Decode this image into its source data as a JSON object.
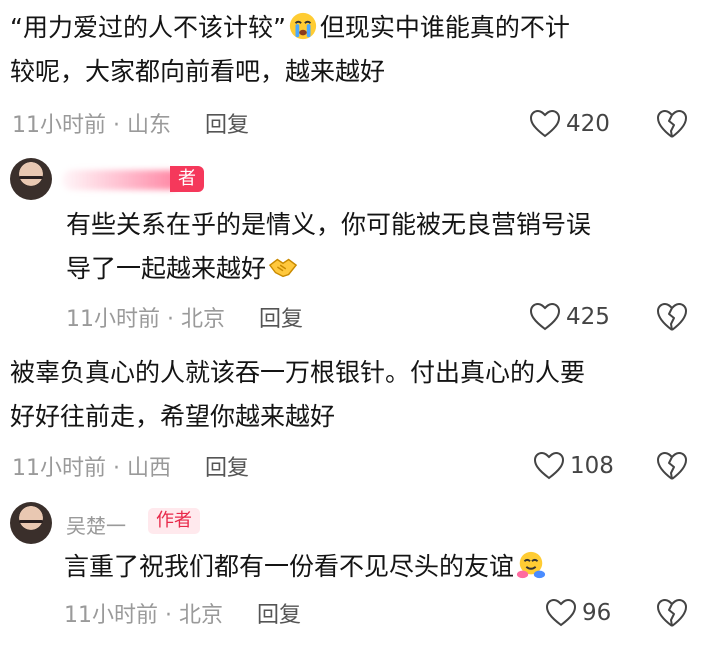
{
  "comments": [
    {
      "lines": [
        "“用力爱过的人不该计较”",
        "但现实中谁能真的不计",
        "较呢，大家都向前看吧，越来越好"
      ],
      "time": "11小时前 · 山东",
      "reply_label": "回复",
      "likes": "420",
      "emoji": "crying-face"
    },
    {
      "author_badge": "者",
      "lines": [
        "有些关系在乎的是情义，你可能被无良营销号误",
        "导了一起越来越好"
      ],
      "time": "11小时前 · 北京",
      "reply_label": "回复",
      "likes": "425",
      "emoji": "handshake"
    },
    {
      "lines": [
        "被辜负真心的人就该吞一万根银针。付出真心的人要",
        "好好往前走，希望你越来越好"
      ],
      "time": "11小时前 · 山西",
      "reply_label": "回复",
      "likes": "108"
    },
    {
      "username": "吴楚一",
      "author_badge": "作者",
      "lines": [
        "言重了祝我们都有一份看不见尽头的友谊"
      ],
      "time": "11小时前 · 北京",
      "reply_label": "回复",
      "likes": "96",
      "emoji": "hugging-face"
    }
  ],
  "colors": {
    "accent": "#f5385b",
    "meta": "#9a9a9a",
    "text": "#141414"
  }
}
